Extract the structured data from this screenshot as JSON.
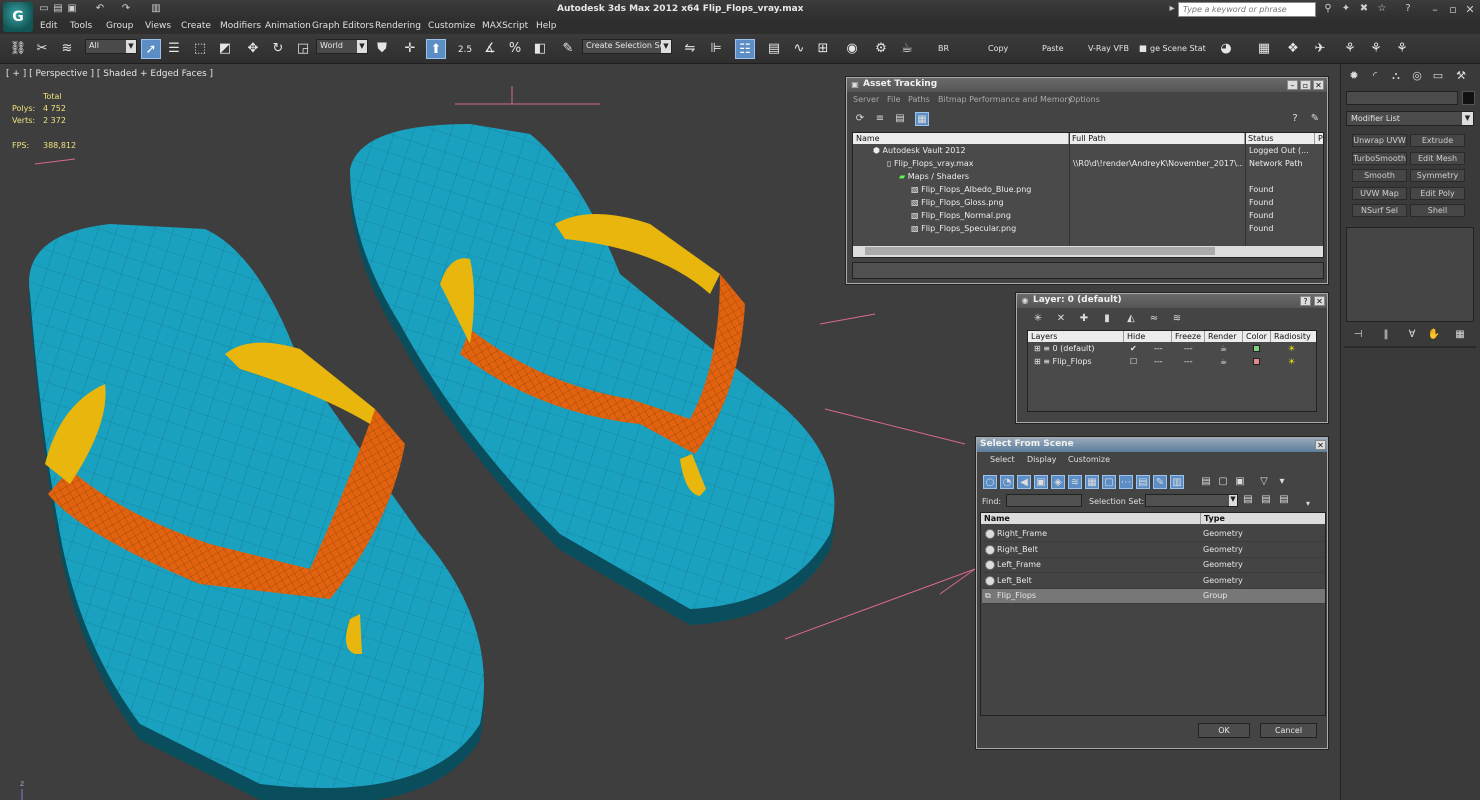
{
  "titlebar": {
    "app_logo": "G",
    "title": "Autodesk 3ds Max  2012 x64     Flip_Flops_vray.max",
    "search_placeholder": "Type a keyword or phrase",
    "quick_access": [
      "new-file-icon",
      "open-icon",
      "save-icon",
      "undo-icon",
      "redo-icon",
      "project-icon"
    ]
  },
  "menu": [
    "Edit",
    "Tools",
    "Group",
    "Views",
    "Create",
    "Modifiers",
    "Animation",
    "Graph Editors",
    "Rendering",
    "Customize",
    "MAXScript",
    "Help"
  ],
  "toolbar": {
    "filter": "All",
    "coord_system": "World",
    "snap_label": "2.5",
    "selection_set": "Create Selection Se",
    "buttons": [
      "BR",
      "Copy",
      "Paste",
      "V-Ray VFB",
      "ge Scene Stat"
    ]
  },
  "viewport": {
    "label": "[ + ] [ Perspective ] [ Shaded + Edged Faces ]",
    "stats": {
      "total_label": "Total",
      "polys_label": "Polys:",
      "polys_value": "4 752",
      "verts_label": "Verts:",
      "verts_value": "2 372",
      "fps_label": "FPS:",
      "fps_value": "388,812"
    },
    "axis_label": "z"
  },
  "colors": {
    "sole": "#1ba1c0",
    "strap": "#e2630f",
    "post": "#e8b60c",
    "viewport_bg": "#3e3e3e",
    "highlight": "#5c8dc4"
  },
  "command_panel": {
    "modifier_list": "Modifier List",
    "modifiers": [
      "Unwrap UVW",
      "Extrude",
      "TurboSmooth",
      "Edit Mesh",
      "Smooth",
      "Symmetry",
      "UVW Map",
      "Edit Poly",
      "NSurf Sel",
      "Shell"
    ]
  },
  "asset_tracking": {
    "title": "Asset Tracking",
    "menu": [
      "Server",
      "File",
      "Paths",
      "Bitmap Performance and Memory",
      "Options"
    ],
    "columns": [
      "Name",
      "Full Path",
      "Status",
      "Pr"
    ],
    "rows": [
      {
        "name": "Autodesk Vault 2012",
        "path": "",
        "status": "Logged Out (..."
      },
      {
        "name": "Flip_Flops_vray.max",
        "path": "\\\\R0\\d\\!render\\AndreyK\\November_2017\\...",
        "status": "Network Path"
      },
      {
        "name": "Maps / Shaders",
        "path": "",
        "status": ""
      },
      {
        "name": "Flip_Flops_Albedo_Blue.png",
        "path": "",
        "status": "Found"
      },
      {
        "name": "Flip_Flops_Gloss.png",
        "path": "",
        "status": "Found"
      },
      {
        "name": "Flip_Flops_Normal.png",
        "path": "",
        "status": "Found"
      },
      {
        "name": "Flip_Flops_Specular.png",
        "path": "",
        "status": "Found"
      }
    ]
  },
  "layer_dialog": {
    "title": "Layer: 0 (default)",
    "columns": [
      "Layers",
      "Hide",
      "Freeze",
      "Render",
      "Color",
      "Radiosity"
    ],
    "rows": [
      {
        "name": "0 (default)",
        "hide": "---",
        "freeze": "---",
        "color": "#7ed37e"
      },
      {
        "name": "Flip_Flops",
        "hide": "---",
        "freeze": "---",
        "color": "#e08a8a"
      }
    ]
  },
  "select_from_scene": {
    "title": "Select From Scene",
    "menu": [
      "Select",
      "Display",
      "Customize"
    ],
    "find_label": "Find:",
    "selection_set_label": "Selection Set:",
    "columns": [
      "Name",
      "Type"
    ],
    "rows": [
      {
        "name": "Right_Frame",
        "type": "Geometry"
      },
      {
        "name": "Right_Belt",
        "type": "Geometry"
      },
      {
        "name": "Left_Frame",
        "type": "Geometry"
      },
      {
        "name": "Left_Belt",
        "type": "Geometry"
      },
      {
        "name": "Flip_Flops",
        "type": "Group"
      }
    ],
    "ok": "OK",
    "cancel": "Cancel"
  }
}
